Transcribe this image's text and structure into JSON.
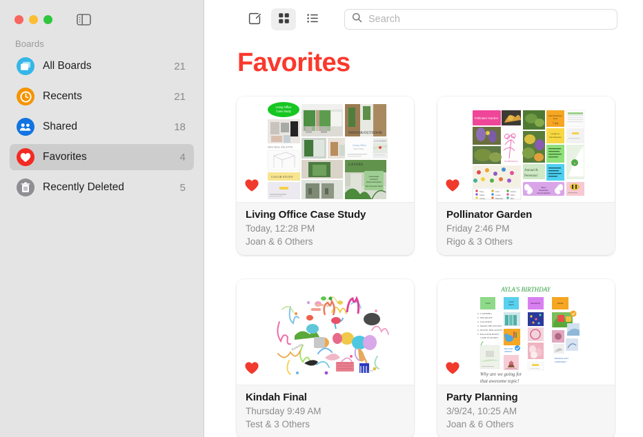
{
  "window": {
    "traffic_lights": [
      "close",
      "minimize",
      "zoom"
    ],
    "sidebar_toggle_icon": "sidebar-toggle-icon"
  },
  "sidebar": {
    "section_label": "Boards",
    "items": [
      {
        "label": "All Boards",
        "count": "21",
        "icon": "boards-icon",
        "color": "#34b7e8",
        "selected": false
      },
      {
        "label": "Recents",
        "count": "21",
        "icon": "clock-icon",
        "color": "#f59300",
        "selected": false
      },
      {
        "label": "Shared",
        "count": "18",
        "icon": "people-icon",
        "color": "#1274e0",
        "selected": false
      },
      {
        "label": "Favorites",
        "count": "4",
        "icon": "heart-icon",
        "color": "#f32a22",
        "selected": true
      },
      {
        "label": "Recently Deleted",
        "count": "5",
        "icon": "trash-icon",
        "color": "#8e8e93",
        "selected": false
      }
    ]
  },
  "toolbar": {
    "compose_icon": "compose-icon",
    "grid_view_icon": "grid-view-icon",
    "list_view_icon": "list-view-icon",
    "active_view": "grid",
    "search": {
      "icon": "search-icon",
      "placeholder": "Search",
      "value": ""
    }
  },
  "main": {
    "title": "Favorites",
    "title_color": "#fb382c",
    "cards": [
      {
        "title": "Living Office Case Study",
        "date": "Today, 12:28 PM",
        "collaborators": "Joan & 6 Others",
        "favorite": true,
        "thumbnail_label": "Living Office Case Study",
        "thumbnail_kind": "interior-architecture-collage"
      },
      {
        "title": "Pollinator Garden",
        "date": "Friday 2:46 PM",
        "collaborators": "Rigo & 3 Others",
        "favorite": true,
        "thumbnail_label": "Pollinator Garden",
        "thumbnail_kind": "garden-plants-collage"
      },
      {
        "title": "Kindah Final",
        "date": "Thursday 9:49 AM",
        "collaborators": "Test & 3 Others",
        "favorite": true,
        "thumbnail_label": "",
        "thumbnail_kind": "colorful-doodle-scribbles"
      },
      {
        "title": "Party Planning",
        "date": "3/9/24, 10:25 AM",
        "collaborators": "Joan & 6 Others",
        "favorite": true,
        "thumbnail_label": "AYLA'S BIRTHDAY",
        "thumbnail_kind": "party-planning-notes"
      }
    ]
  }
}
